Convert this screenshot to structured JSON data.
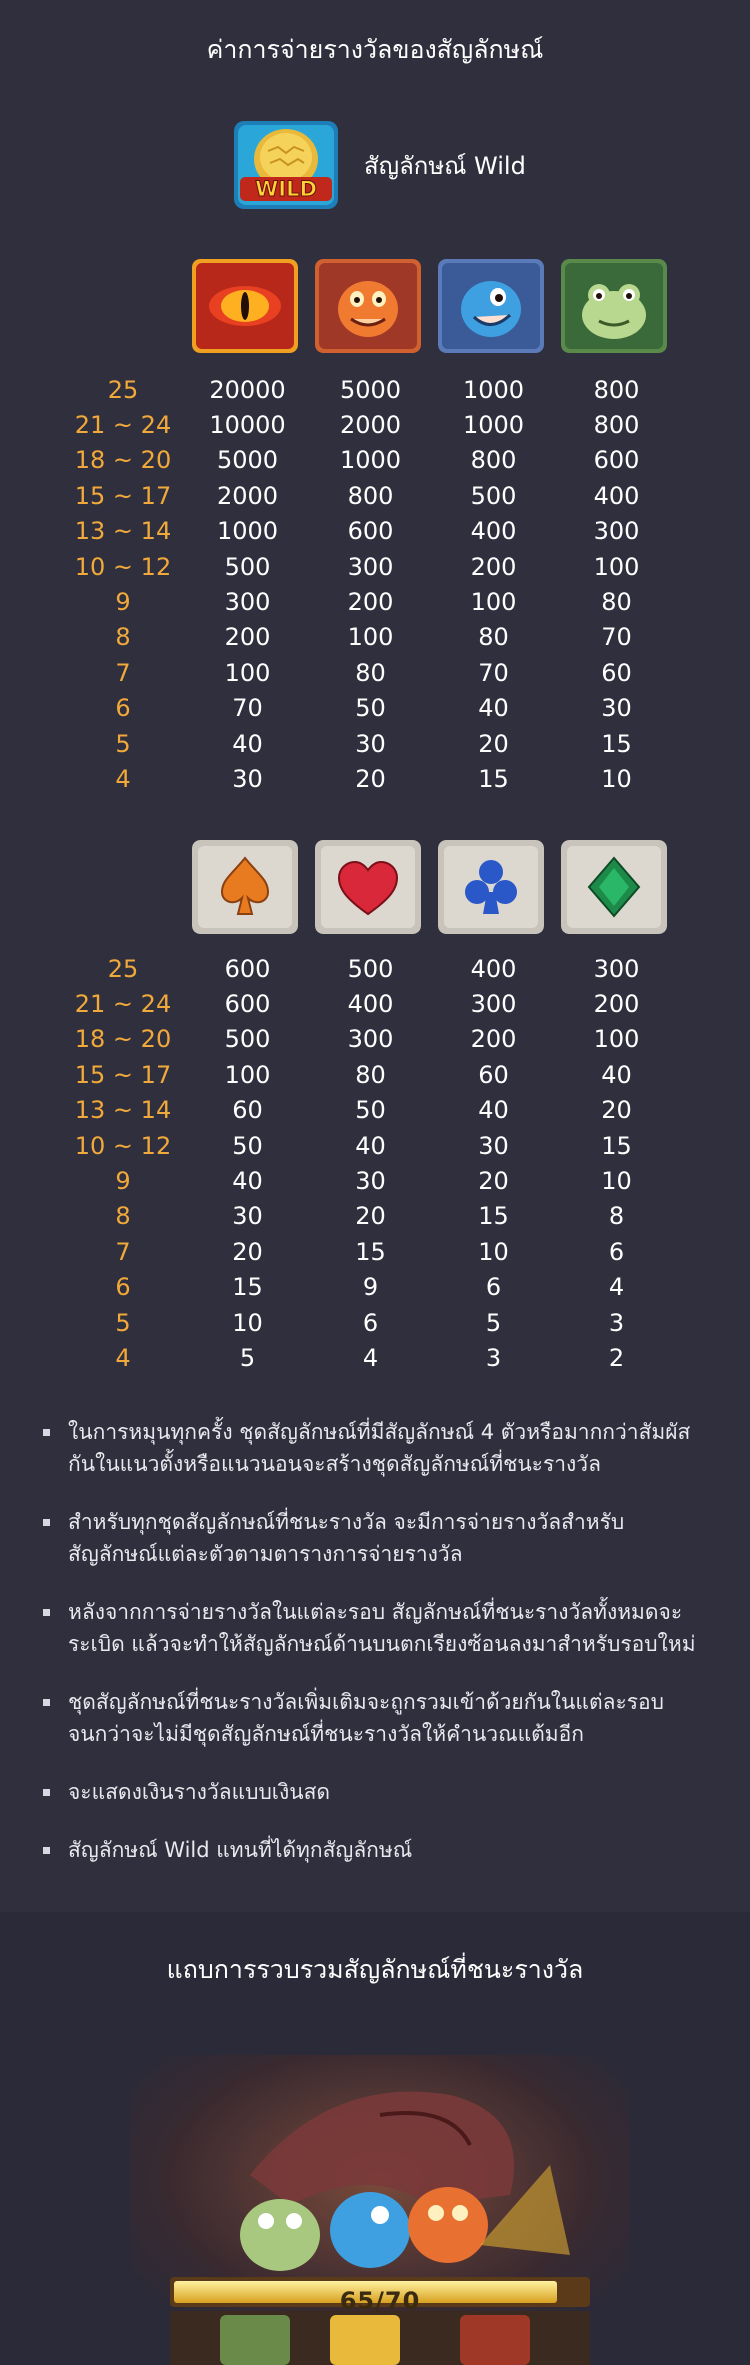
{
  "header": {
    "title": "ค่าการจ่ายรางวัลของสัญลักษณ์"
  },
  "wild": {
    "icon": "wild-egg-icon",
    "label": "สัญลักษณ์ Wild"
  },
  "high_symbols": {
    "icons": [
      "dragon-eye-icon",
      "orange-dragon-icon",
      "blue-dragon-icon",
      "green-frog-icon"
    ],
    "rows": [
      {
        "count": "25",
        "values": [
          "20000",
          "5000",
          "1000",
          "800"
        ]
      },
      {
        "count": "21 ~ 24",
        "values": [
          "10000",
          "2000",
          "1000",
          "800"
        ]
      },
      {
        "count": "18 ~ 20",
        "values": [
          "5000",
          "1000",
          "800",
          "600"
        ]
      },
      {
        "count": "15 ~ 17",
        "values": [
          "2000",
          "800",
          "500",
          "400"
        ]
      },
      {
        "count": "13 ~ 14",
        "values": [
          "1000",
          "600",
          "400",
          "300"
        ]
      },
      {
        "count": "10 ~ 12",
        "values": [
          "500",
          "300",
          "200",
          "100"
        ]
      },
      {
        "count": "9",
        "values": [
          "300",
          "200",
          "100",
          "80"
        ]
      },
      {
        "count": "8",
        "values": [
          "200",
          "100",
          "80",
          "70"
        ]
      },
      {
        "count": "7",
        "values": [
          "100",
          "80",
          "70",
          "60"
        ]
      },
      {
        "count": "6",
        "values": [
          "70",
          "50",
          "40",
          "30"
        ]
      },
      {
        "count": "5",
        "values": [
          "40",
          "30",
          "20",
          "15"
        ]
      },
      {
        "count": "4",
        "values": [
          "30",
          "20",
          "15",
          "10"
        ]
      }
    ]
  },
  "low_symbols": {
    "icons": [
      "spade-icon",
      "heart-icon",
      "club-icon",
      "diamond-icon"
    ],
    "rows": [
      {
        "count": "25",
        "values": [
          "600",
          "500",
          "400",
          "300"
        ]
      },
      {
        "count": "21 ~ 24",
        "values": [
          "600",
          "400",
          "300",
          "200"
        ]
      },
      {
        "count": "18 ~ 20",
        "values": [
          "500",
          "300",
          "200",
          "100"
        ]
      },
      {
        "count": "15 ~ 17",
        "values": [
          "100",
          "80",
          "60",
          "40"
        ]
      },
      {
        "count": "13 ~ 14",
        "values": [
          "60",
          "50",
          "40",
          "20"
        ]
      },
      {
        "count": "10 ~ 12",
        "values": [
          "50",
          "40",
          "30",
          "15"
        ]
      },
      {
        "count": "9",
        "values": [
          "40",
          "30",
          "20",
          "10"
        ]
      },
      {
        "count": "8",
        "values": [
          "30",
          "20",
          "15",
          "8"
        ]
      },
      {
        "count": "7",
        "values": [
          "20",
          "15",
          "10",
          "6"
        ]
      },
      {
        "count": "6",
        "values": [
          "15",
          "9",
          "6",
          "4"
        ]
      },
      {
        "count": "5",
        "values": [
          "10",
          "6",
          "5",
          "3"
        ]
      },
      {
        "count": "4",
        "values": [
          "5",
          "4",
          "3",
          "2"
        ]
      }
    ]
  },
  "rules": [
    "ในการหมุนทุกครั้ง ชุดสัญลักษณ์ที่มีสัญลักษณ์ 4 ตัวหรือมากกว่าสัมผัสกันในแนวตั้งหรือแนวนอนจะสร้างชุดสัญลักษณ์ที่ชนะรางวัล",
    "สำหรับทุกชุดสัญลักษณ์ที่ชนะรางวัล จะมีการจ่ายรางวัลสำหรับสัญลักษณ์แต่ละตัวตามตารางการจ่ายรางวัล",
    "หลังจากการจ่ายรางวัลในแต่ละรอบ สัญลักษณ์ที่ชนะรางวัลทั้งหมดจะระเบิด แล้วจะทำให้สัญลักษณ์ด้านบนตกเรียงซ้อนลงมาสำหรับรอบใหม่",
    "ชุดสัญลักษณ์ที่ชนะรางวัลเพิ่มเติมจะถูกรวมเข้าด้วยกันในแต่ละรอบจนกว่าจะไม่มีชุดสัญลักษณ์ที่ชนะรางวัลให้คำนวณแต้มอีก",
    "จะแสดงเงินรางวัลแบบเงินสด",
    "สัญลักษณ์ Wild แทนที่ได้ทุกสัญลักษณ์"
  ],
  "collection": {
    "title": "แถบการรวบรวมสัญลักษณ์ที่ชนะรางวัล",
    "progress_text": "65/70",
    "progress_fraction": 0.93
  },
  "colors": {
    "background": "#302f3d",
    "count_text": "#f0a93a",
    "value_text": "#ffffff"
  }
}
